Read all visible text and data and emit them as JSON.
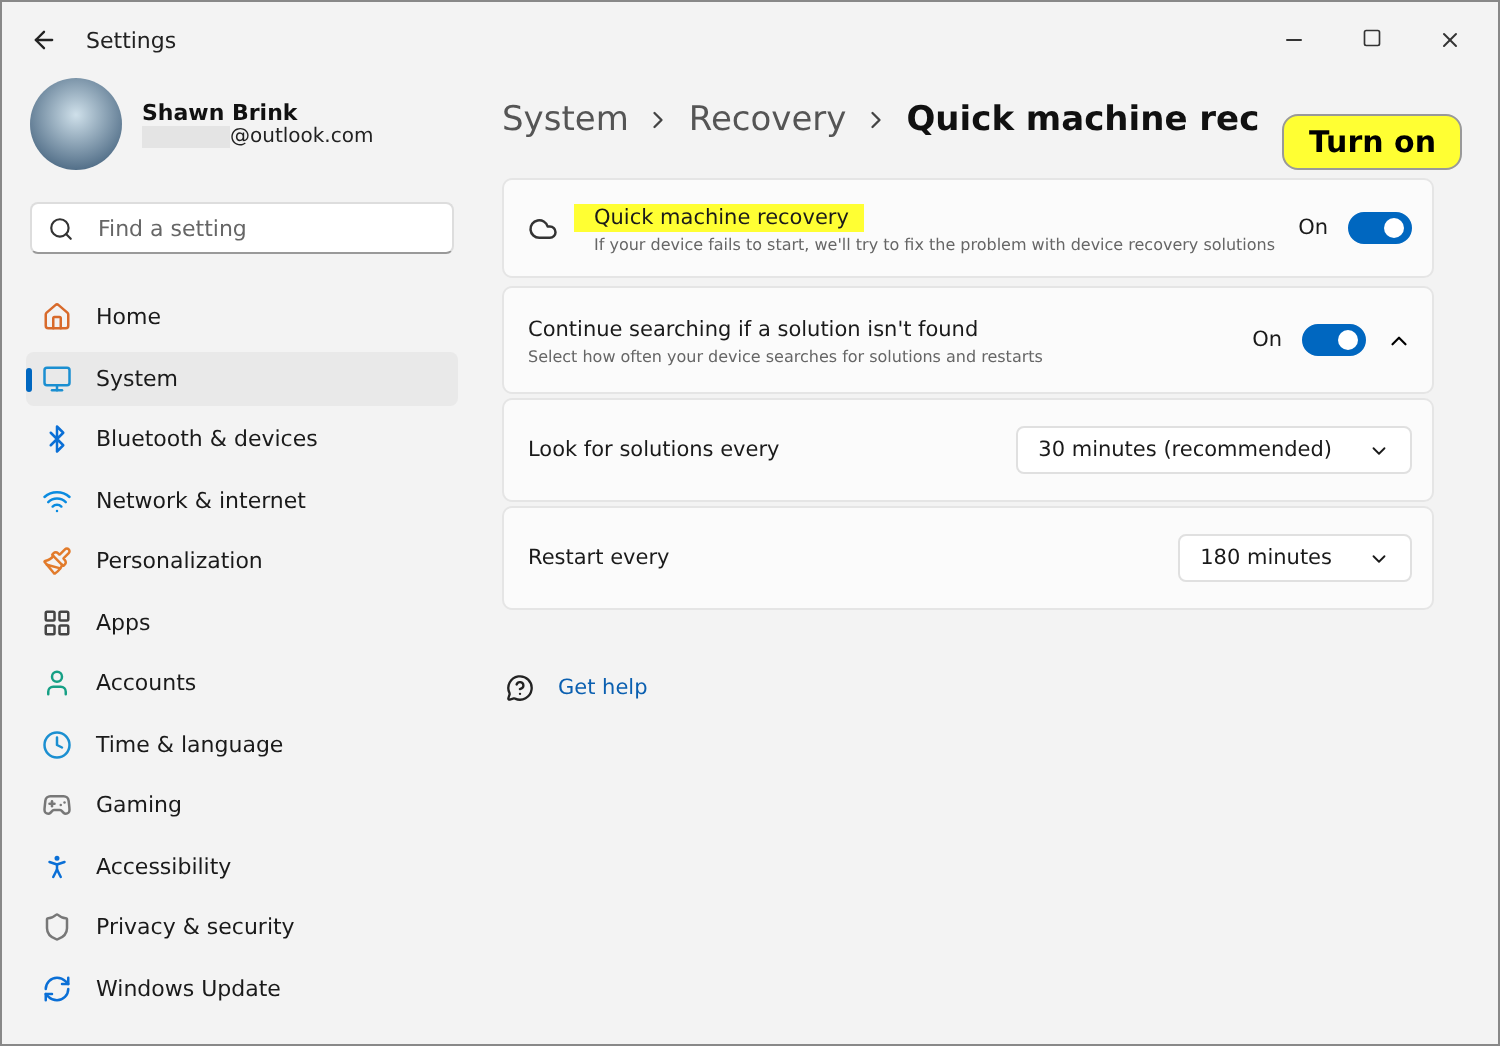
{
  "window": {
    "title": "Settings"
  },
  "account": {
    "name": "Shawn Brink",
    "email": "@outlook.com"
  },
  "search": {
    "placeholder": "Find a setting"
  },
  "sidebar": {
    "items": [
      {
        "label": "Home",
        "selected": false
      },
      {
        "label": "System",
        "selected": true
      },
      {
        "label": "Bluetooth & devices",
        "selected": false
      },
      {
        "label": "Network & internet",
        "selected": false
      },
      {
        "label": "Personalization",
        "selected": false
      },
      {
        "label": "Apps",
        "selected": false
      },
      {
        "label": "Accounts",
        "selected": false
      },
      {
        "label": "Time & language",
        "selected": false
      },
      {
        "label": "Gaming",
        "selected": false
      },
      {
        "label": "Accessibility",
        "selected": false
      },
      {
        "label": "Privacy & security",
        "selected": false
      },
      {
        "label": "Windows Update",
        "selected": false
      }
    ]
  },
  "breadcrumb": [
    "System",
    "Recovery",
    "Quick machine rec"
  ],
  "cards": [
    {
      "kind": "toggle",
      "title": "Quick machine recovery",
      "subtitle": "If your device fails to start, we'll try to fix the problem with device recovery solutions",
      "state_label": "On",
      "on": true,
      "highlighted": true
    },
    {
      "kind": "toggle",
      "title": "Continue searching if a solution isn't found",
      "subtitle": "Select how often your device searches for solutions and restarts",
      "state_label": "On",
      "on": true,
      "highlighted": false,
      "expanded": true
    },
    {
      "kind": "select",
      "title": "Look for solutions every",
      "value": "30 minutes (recommended)"
    },
    {
      "kind": "select",
      "title": "Restart every",
      "value": "180 minutes"
    }
  ],
  "help_link": "Get help",
  "callout": {
    "text": "Turn on"
  }
}
